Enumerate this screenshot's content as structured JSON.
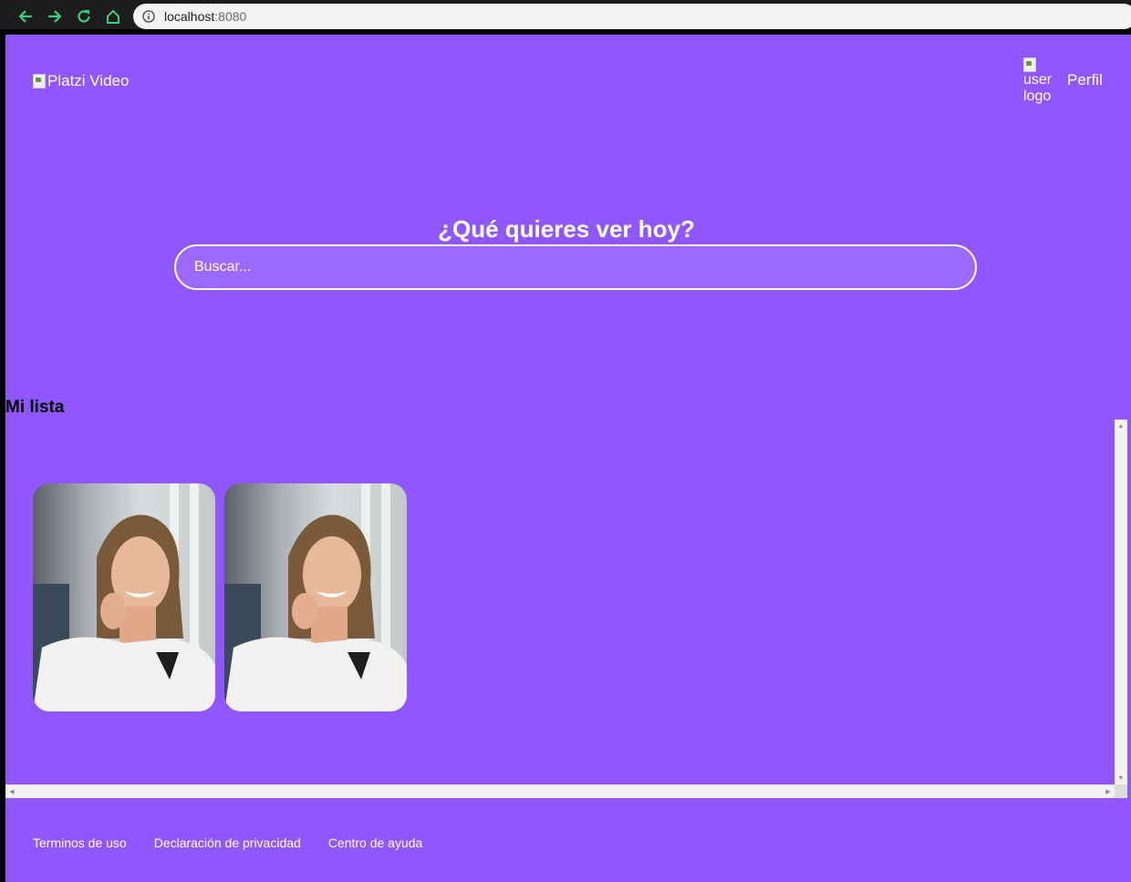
{
  "browser": {
    "url_host": "localhost",
    "url_port": ":8080"
  },
  "header": {
    "logo_alt": "Platzi Video",
    "user_logo_alt": "user logo",
    "profile_label": "Perfil"
  },
  "hero": {
    "title": "¿Qué quieres ver hoy?",
    "search_placeholder": "Buscar..."
  },
  "my_list": {
    "title": "Mi lista",
    "items": [
      {
        "image": "woman-smiling-phone-photo"
      },
      {
        "image": "woman-smiling-phone-photo"
      }
    ]
  },
  "footer": {
    "links": [
      "Terminos de uso",
      "Declaración de privacidad",
      "Centro de ayuda"
    ]
  },
  "colors": {
    "page_background": "#8f57fd",
    "search_background": "#9d68fd",
    "browser_accent": "#3ad07a"
  }
}
